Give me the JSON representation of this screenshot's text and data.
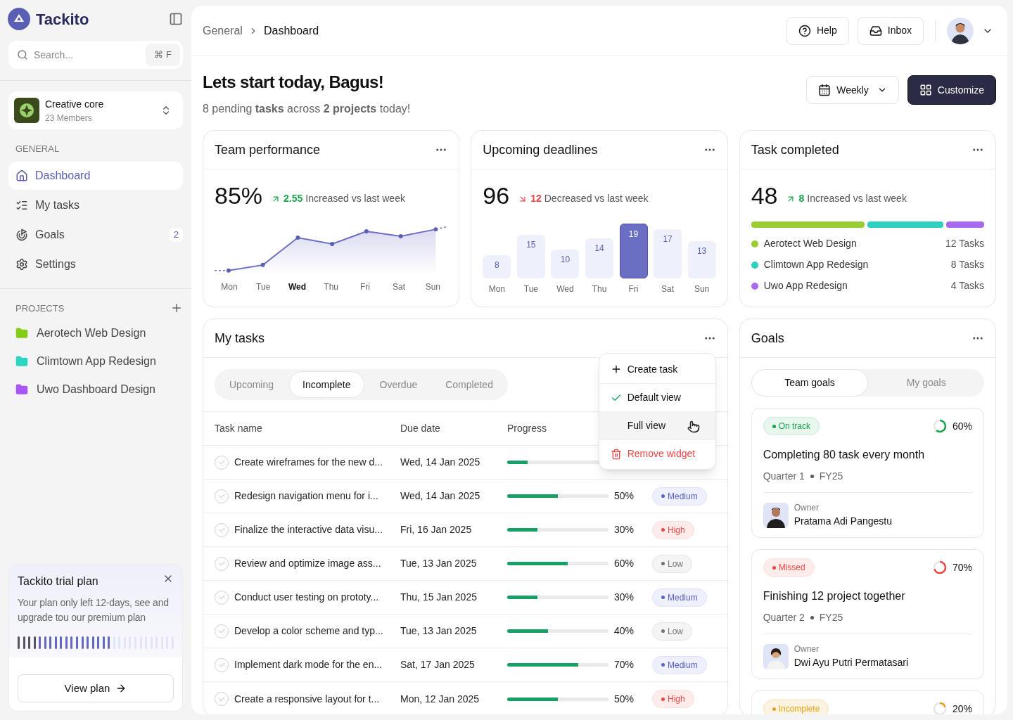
{
  "sidebar": {
    "brand": "Tackito",
    "search": {
      "placeholder": "Search...",
      "shortcut": "⌘ F"
    },
    "workspace": {
      "name": "Creative core",
      "members": "23 Members"
    },
    "general_label": "GENERAL",
    "nav": [
      {
        "label": "Dashboard",
        "selected": true
      },
      {
        "label": "My tasks",
        "selected": false
      },
      {
        "label": "Goals",
        "selected": false,
        "badge": "2"
      },
      {
        "label": "Settings",
        "selected": false
      }
    ],
    "projects_label": "PROJECTS",
    "projects": [
      {
        "name": "Aerotech Web Design",
        "color": "#84cc16"
      },
      {
        "name": "Climtown App Redesign",
        "color": "#2dd4bf"
      },
      {
        "name": "Uwo Dashboard Design",
        "color": "#a855f7"
      }
    ],
    "trial": {
      "title": "Tackito trial plan",
      "text": "Your plan only left 12-days, see and upgrade tou our premium plan",
      "level": 0.6,
      "button": "View plan"
    }
  },
  "header": {
    "breadcrumb": [
      "General",
      "Dashboard"
    ],
    "help": "Help",
    "inbox": "Inbox"
  },
  "greeting": {
    "title": "Lets start today, Bagus!",
    "subtitle": "8 pending **tasks** across **2 projects** today!",
    "period": "Weekly",
    "customize": "Customize"
  },
  "team_performance": {
    "title": "Team performance",
    "value": "85%",
    "delta": "2.55",
    "increased": true,
    "delta_text": "Increased vs last week",
    "days": [
      {
        "label": "Mon",
        "selected": false
      },
      {
        "label": "Tue",
        "selected": false
      },
      {
        "label": "Wed",
        "selected": true
      },
      {
        "label": "Thu",
        "selected": false
      },
      {
        "label": "Fri",
        "selected": false
      },
      {
        "label": "Sat",
        "selected": false
      },
      {
        "label": "Sun",
        "selected": false
      }
    ]
  },
  "upcoming_deadlines": {
    "title": "Upcoming deadlines",
    "value": "96",
    "delta": "12",
    "increased": false,
    "delta_text": "Decreased vs last week",
    "highlighted": [
      false,
      false,
      false,
      false,
      true,
      false,
      false
    ],
    "chart_data": {
      "type": "bar",
      "categories": [
        "Mon",
        "Tue",
        "Wed",
        "Thu",
        "Fri",
        "Sat",
        "Sun"
      ],
      "values": [
        8,
        15,
        10,
        14,
        19,
        17,
        13
      ],
      "data_labels": true
    }
  },
  "task_completed": {
    "title": "Task completed",
    "value": "48",
    "delta": "8",
    "increased": true,
    "delta_text": "Increased vs last week",
    "projects": [
      {
        "name": "Aerotect Web Design",
        "count": "12 Tasks",
        "color": "#9acd32"
      },
      {
        "name": "Climtown App Redesign",
        "count": "8 Tasks",
        "color": "#2ccfc0"
      },
      {
        "name": "Uwo App Redesign",
        "count": "4 Tasks",
        "color": "#a66af0"
      }
    ]
  },
  "my_tasks": {
    "title": "My tasks",
    "tabs": [
      {
        "label": "Upcoming",
        "selected": false
      },
      {
        "label": "Incomplete",
        "selected": true
      },
      {
        "label": "Overdue",
        "selected": false
      },
      {
        "label": "Completed",
        "selected": false
      }
    ],
    "columns": [
      "Task name",
      "Due date",
      "Progress"
    ],
    "rows": [
      {
        "name": "Create wireframes for the new d...",
        "due": "Wed, 14 Jan 2025",
        "level": 0.2
      },
      {
        "name": "Redesign navigation menu for i...",
        "due": "Wed, 14 Jan 2025",
        "level": 0.5,
        "reading": "50%",
        "priority": {
          "label": "Medium",
          "kind": "medium"
        }
      },
      {
        "name": "Finalize the interactive data visu...",
        "due": "Fri, 16 Jan 2025",
        "level": 0.3,
        "reading": "30%",
        "priority": {
          "label": "High",
          "kind": "high"
        }
      },
      {
        "name": "Review and optimize image ass...",
        "due": "Tue, 13 Jan 2025",
        "level": 0.6,
        "reading": "60%",
        "priority": {
          "label": "Low",
          "kind": "low"
        }
      },
      {
        "name": "Conduct user testing on prototy...",
        "due": "Thu, 15 Jan 2025",
        "level": 0.3,
        "reading": "30%",
        "priority": {
          "label": "Medium",
          "kind": "medium"
        }
      },
      {
        "name": "Develop a color scheme and typ...",
        "due": "Tue, 13 Jan 2025",
        "level": 0.4,
        "reading": "40%",
        "priority": {
          "label": "Low",
          "kind": "low"
        }
      },
      {
        "name": "Implement dark mode for the en...",
        "due": "Sat, 17 Jan 2025",
        "level": 0.7,
        "reading": "70%",
        "priority": {
          "label": "Medium",
          "kind": "medium"
        }
      },
      {
        "name": "Create a responsive layout for t...",
        "due": "Mon, 12 Jan 2025",
        "level": 0.5,
        "reading": "50%",
        "priority": {
          "label": "High",
          "kind": "high"
        }
      }
    ],
    "menu": [
      {
        "label": "Create task",
        "kind": "add",
        "checked": false,
        "hovered": false
      },
      {
        "label": "Default view",
        "kind": "option",
        "checked": true,
        "hovered": false
      },
      {
        "label": "Full view",
        "kind": "option",
        "checked": false,
        "hovered": true
      },
      {
        "label": "Remove widget",
        "kind": "danger",
        "checked": false,
        "hovered": false
      }
    ]
  },
  "goals": {
    "title": "Goals",
    "tabs": [
      {
        "label": "Team goals",
        "selected": true
      },
      {
        "label": "My goals",
        "selected": false
      }
    ],
    "cards": [
      {
        "status": {
          "label": "On track",
          "kind": "on_track"
        },
        "reading": "60%",
        "title": "Completing 80 task every month",
        "quarter": "Quarter 1",
        "year": "FY25",
        "owner_label": "Owner",
        "owner": "Pratama Adi Pangestu"
      },
      {
        "status": {
          "label": "Missed",
          "kind": "missed"
        },
        "reading": "70%",
        "title": "Finishing 12 project together",
        "quarter": "Quarter 2",
        "year": "FY25",
        "owner_label": "Owner",
        "owner": "Dwi Ayu Putri Permatasari"
      },
      {
        "status": {
          "label": "Incomplete",
          "kind": "incomplete"
        },
        "reading": "20%"
      }
    ]
  }
}
